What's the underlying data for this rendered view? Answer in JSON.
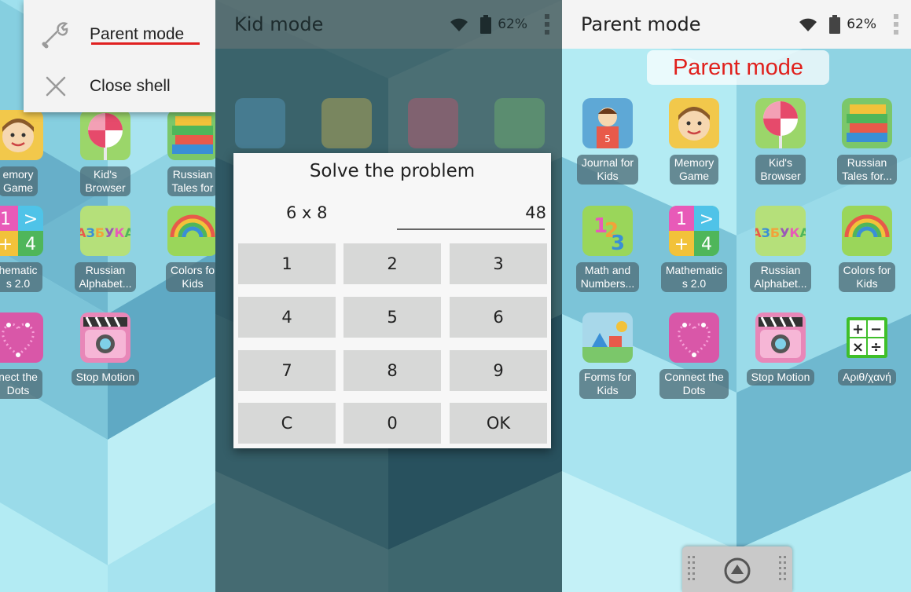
{
  "left_panel": {
    "menu": {
      "items": [
        {
          "label": "Parent mode",
          "icon": "wrench-icon"
        },
        {
          "label": "Close shell",
          "icon": "close-icon"
        }
      ]
    },
    "apps": [
      {
        "label": "emory\nGame",
        "icon": "memory-game-icon"
      },
      {
        "label": "Kid's\nBrowser",
        "icon": "lollipop-icon"
      },
      {
        "label": "Russian\nTales for",
        "icon": "books-icon"
      },
      {
        "label": "hematic\ns 2.0",
        "icon": "math-icon"
      },
      {
        "label": "Russian\nAlphabet...",
        "icon": "alphabet-icon"
      },
      {
        "label": "Colors fo\nKids",
        "icon": "rainbow-icon"
      },
      {
        "label": "nect the\nDots",
        "icon": "heart-dots-icon"
      },
      {
        "label": "Stop Motion",
        "icon": "camera-icon"
      }
    ]
  },
  "middle_panel": {
    "title": "Kid mode",
    "battery": "62%",
    "dialog": {
      "title": "Solve the problem",
      "problem": "6 x 8",
      "answer": "48",
      "keys": [
        "1",
        "2",
        "3",
        "4",
        "5",
        "6",
        "7",
        "8",
        "9",
        "C",
        "0",
        "OK"
      ]
    }
  },
  "right_panel": {
    "title": "Parent mode",
    "battery": "62%",
    "banner": "Parent mode",
    "apps": [
      {
        "label": "Journal for\nKids",
        "icon": "journal-icon"
      },
      {
        "label": "Memory\nGame",
        "icon": "memory-game-icon"
      },
      {
        "label": "Kid's\nBrowser",
        "icon": "lollipop-icon"
      },
      {
        "label": "Russian\nTales for...",
        "icon": "books-icon"
      },
      {
        "label": "Math and\nNumbers...",
        "icon": "numbers-icon"
      },
      {
        "label": "Mathematic\ns 2.0",
        "icon": "math-icon"
      },
      {
        "label": "Russian\nAlphabet...",
        "icon": "alphabet-icon"
      },
      {
        "label": "Colors for\nKids",
        "icon": "rainbow-icon"
      },
      {
        "label": "Forms for\nKids",
        "icon": "forms-icon"
      },
      {
        "label": "Connect the\nDots",
        "icon": "heart-dots-icon"
      },
      {
        "label": "Stop Motion",
        "icon": "camera-icon"
      },
      {
        "label": "Αριθ/χανή",
        "icon": "calculator-icon"
      }
    ]
  }
}
